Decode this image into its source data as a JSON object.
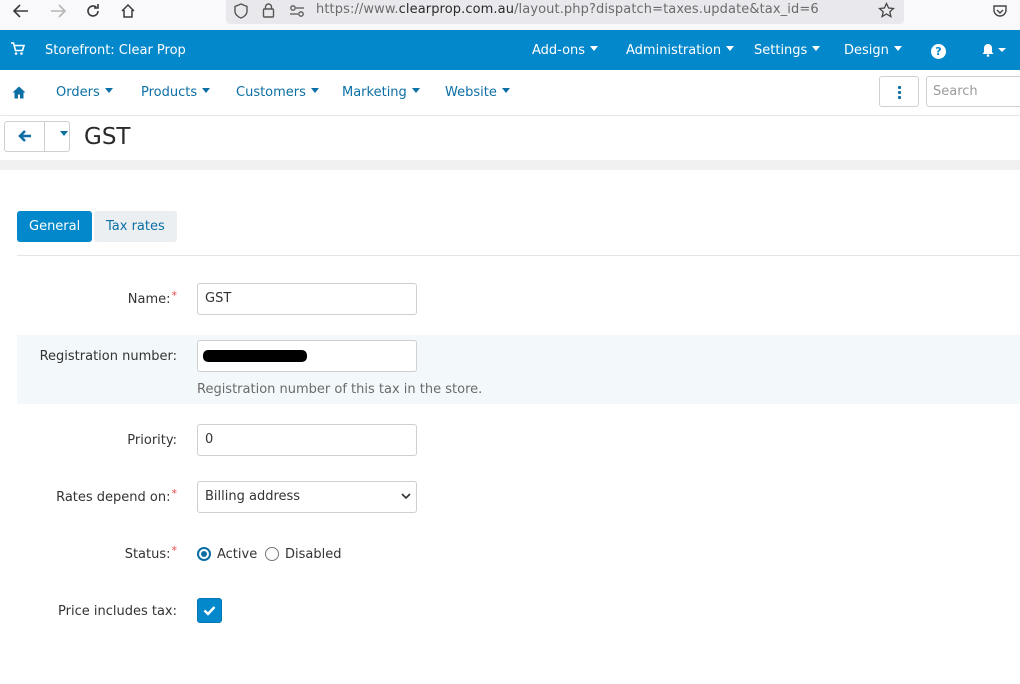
{
  "browser": {
    "url_prefix": "https://www.",
    "url_host": "clearprop.com.au",
    "url_path": "/layout.php?dispatch=taxes.update&tax_id=6"
  },
  "topbar": {
    "store_label": "Storefront: Clear Prop",
    "menu": [
      "Add-ons",
      "Administration",
      "Settings",
      "Design"
    ],
    "help_glyph": "?"
  },
  "subnav": {
    "items": [
      "Orders",
      "Products",
      "Customers",
      "Marketing",
      "Website"
    ],
    "search_placeholder": "Search"
  },
  "page": {
    "title": "GST"
  },
  "tabs": {
    "general": "General",
    "tax_rates": "Tax rates"
  },
  "form": {
    "name_label": "Name:",
    "name_value": "GST",
    "regnum_label": "Registration number:",
    "regnum_help": "Registration number of this tax in the store.",
    "priority_label": "Priority:",
    "priority_value": "0",
    "rates_label": "Rates depend on:",
    "rates_value": "Billing address",
    "status_label": "Status:",
    "status_active": "Active",
    "status_disabled": "Disabled",
    "status_selected": "Active",
    "price_tax_label": "Price includes tax:",
    "price_tax_checked": true
  },
  "colors": {
    "primary": "#0388cc",
    "link": "#0b6fa5",
    "required": "#e04848"
  }
}
